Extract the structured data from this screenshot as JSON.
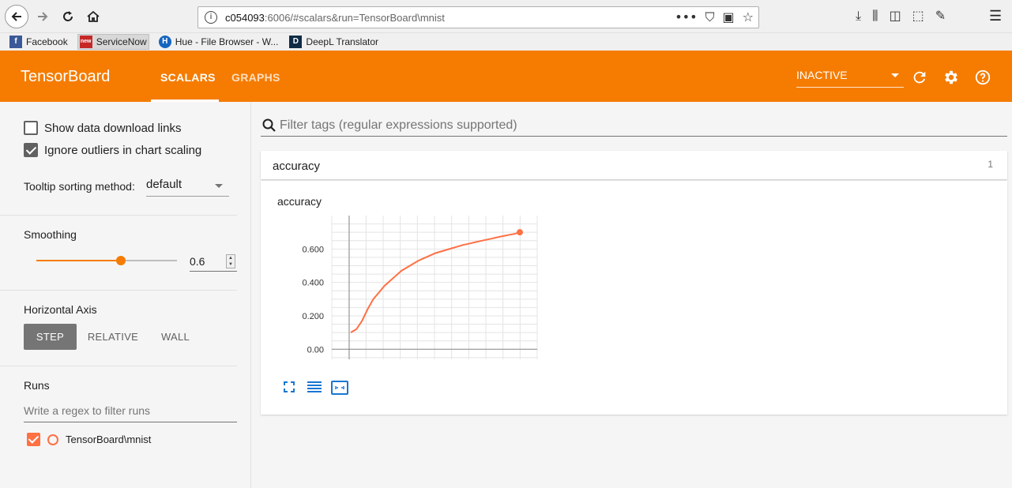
{
  "browser": {
    "url_host": "c054093",
    "url_rest": ":6006/#scalars&run=TensorBoard\\mnist",
    "bookmarks": [
      {
        "label": "Facebook",
        "icon_color": "#3b5998",
        "icon_text": "f"
      },
      {
        "label": "ServiceNow",
        "icon_color": "#c62828",
        "icon_text": "new"
      },
      {
        "label": "Hue - File Browser - W...",
        "icon_color": "#1565c0",
        "icon_text": "H"
      },
      {
        "label": "DeepL Translator",
        "icon_color": "#0f2b46",
        "icon_text": "D"
      }
    ]
  },
  "header": {
    "title": "TensorBoard",
    "tabs": [
      {
        "label": "SCALARS"
      },
      {
        "label": "GRAPHS"
      }
    ],
    "status_select": "INACTIVE",
    "accent": "#f57c00"
  },
  "sidebar": {
    "show_download_links": {
      "label": "Show data download links",
      "checked": false
    },
    "ignore_outliers": {
      "label": "Ignore outliers in chart scaling",
      "checked": true
    },
    "tooltip_sorting": {
      "label": "Tooltip sorting method:",
      "value": "default"
    },
    "smoothing": {
      "label": "Smoothing",
      "value": "0.6",
      "fraction": 0.6
    },
    "horizontal_axis": {
      "label": "Horizontal Axis",
      "options": [
        "STEP",
        "RELATIVE",
        "WALL"
      ],
      "selected": "STEP"
    },
    "runs": {
      "label": "Runs",
      "filter_placeholder": "Write a regex to filter runs",
      "items": [
        {
          "name": "TensorBoard\\mnist",
          "checked": true,
          "color": "#ff7043"
        }
      ]
    }
  },
  "main": {
    "filter_placeholder": "Filter tags (regular expressions supported)",
    "category": {
      "name": "accuracy",
      "count": "1"
    },
    "card": {
      "title": "accuracy"
    }
  },
  "chart_data": {
    "type": "line",
    "title": "accuracy",
    "xlabel": "",
    "ylabel": "",
    "y_tick_labels": [
      "0.00",
      "0.200",
      "0.400",
      "0.600"
    ],
    "ylim": [
      -0.06,
      0.8
    ],
    "series": [
      {
        "name": "TensorBoard\\mnist",
        "color": "#ff7043",
        "x": [
          0,
          1,
          2,
          3,
          4,
          5,
          6,
          7,
          8,
          9,
          10,
          11,
          12,
          13,
          14,
          15,
          16,
          17,
          18,
          19,
          20,
          21,
          22,
          23,
          24,
          25,
          26,
          27,
          28,
          29,
          30
        ],
        "y": [
          0.1,
          0.12,
          0.17,
          0.24,
          0.3,
          0.34,
          0.38,
          0.41,
          0.44,
          0.47,
          0.49,
          0.51,
          0.53,
          0.545,
          0.56,
          0.575,
          0.585,
          0.595,
          0.605,
          0.615,
          0.625,
          0.632,
          0.64,
          0.648,
          0.655,
          0.662,
          0.67,
          0.677,
          0.684,
          0.69,
          0.7
        ]
      }
    ],
    "grid": true
  }
}
